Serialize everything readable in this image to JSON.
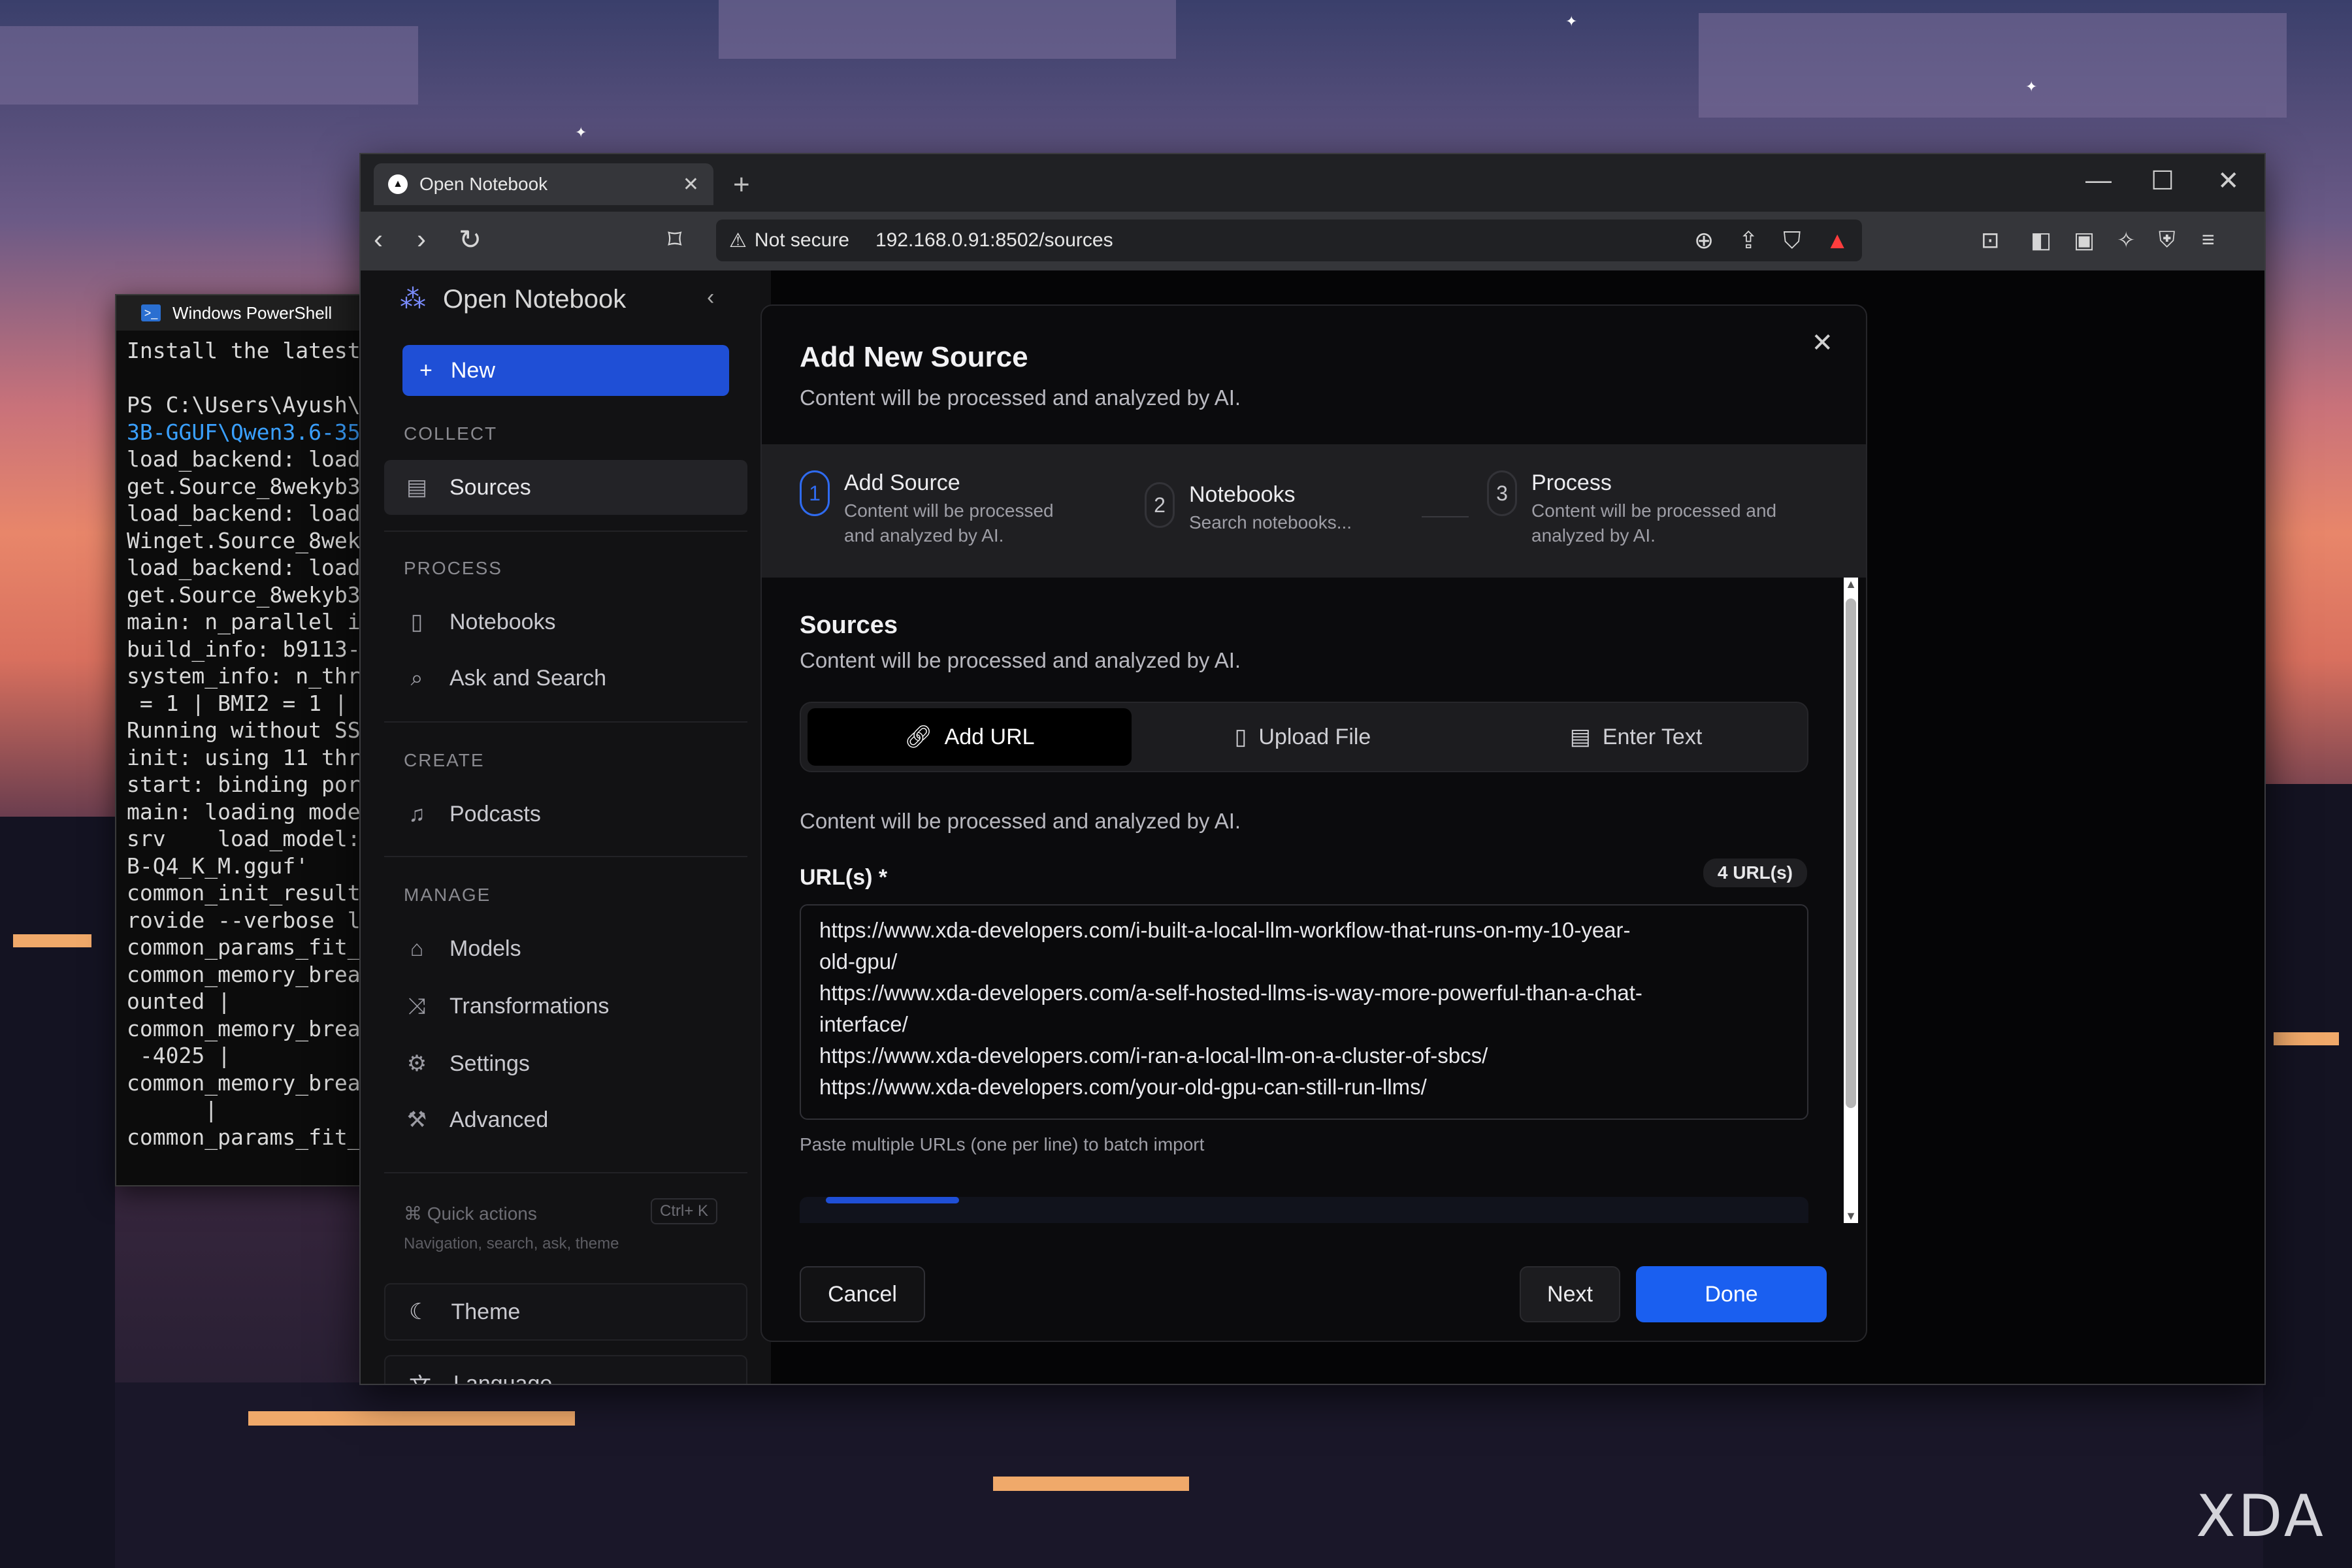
{
  "wallpaper": {
    "watermark": "XDA"
  },
  "powershell": {
    "title": "Windows PowerShell",
    "lines": [
      "Install the latest",
      "",
      "PS C:\\Users\\Ayush\\",
      "3B-GGUF\\Qwen3.6-35",
      "load_backend: load",
      "get.Source_8wekyb3",
      "load_backend: load",
      "Winget.Source_8wek",
      "load_backend: load",
      "get.Source_8wekyb3",
      "main: n_parallel i",
      "build_info: b9113-",
      "system_info: n_thr",
      " = 1 | BMI2 = 1 |",
      "Running without SS",
      "init: using 11 thr",
      "start: binding por",
      "main: loading mode",
      "srv    load_model:",
      "B-Q4_K_M.gguf'",
      "common_init_result",
      "rovide --verbose l",
      "common_params_fit_",
      "common_memory_brea",
      "ounted |",
      "common_memory_brea",
      " -4025 |",
      "common_memory_brea",
      "      |",
      "common_params_fit_"
    ]
  },
  "browser": {
    "tab_title": "Open Notebook",
    "security": "Not secure",
    "url": "192.168.0.91:8502/sources"
  },
  "sidebar": {
    "app_name": "Open Notebook",
    "new_label": "New",
    "sections": {
      "collect": "COLLECT",
      "process": "PROCESS",
      "create": "CREATE",
      "manage": "MANAGE"
    },
    "items": {
      "sources": "Sources",
      "notebooks": "Notebooks",
      "ask": "Ask and Search",
      "podcasts": "Podcasts",
      "models": "Models",
      "transformations": "Transformations",
      "settings": "Settings",
      "advanced": "Advanced"
    },
    "quick_actions": "Quick actions",
    "quick_shortcut": "Ctrl+ K",
    "quick_sub": "Navigation, search, ask, theme",
    "theme": "Theme",
    "language": "Language"
  },
  "modal": {
    "title": "Add New Source",
    "subtitle": "Content will be processed and analyzed by AI.",
    "steps": [
      {
        "num": "1",
        "title": "Add Source",
        "desc1": "Content will be processed",
        "desc2": "and analyzed by AI."
      },
      {
        "num": "2",
        "title": "Notebooks",
        "desc1": "Search notebooks...",
        "desc2": ""
      },
      {
        "num": "3",
        "title": "Process",
        "desc1": "Content will be processed and",
        "desc2": "analyzed by AI."
      }
    ],
    "sources_heading": "Sources",
    "sources_sub": "Content will be processed and analyzed by AI.",
    "tabs": [
      "Add URL",
      "Upload File",
      "Enter Text"
    ],
    "content_note": "Content will be processed and analyzed by AI.",
    "url_label": "URL(s) *",
    "url_count": "4 URL(s)",
    "url_lines": [
      "https://www.xda-developers.com/i-built-a-local-llm-workflow-that-runs-on-my-10-year-",
      "old-gpu/",
      "https://www.xda-developers.com/a-self-hosted-llms-is-way-more-powerful-than-a-chat-",
      "interface/",
      "https://www.xda-developers.com/i-ran-a-local-llm-on-a-cluster-of-sbcs/",
      "https://www.xda-developers.com/your-old-gpu-can-still-run-llms/"
    ],
    "url_help": "Paste multiple URLs (one per line) to batch import",
    "cancel": "Cancel",
    "next": "Next",
    "done": "Done"
  },
  "colors": {
    "accent": "#1a5ff0",
    "step_active": "#2f6bf0"
  }
}
